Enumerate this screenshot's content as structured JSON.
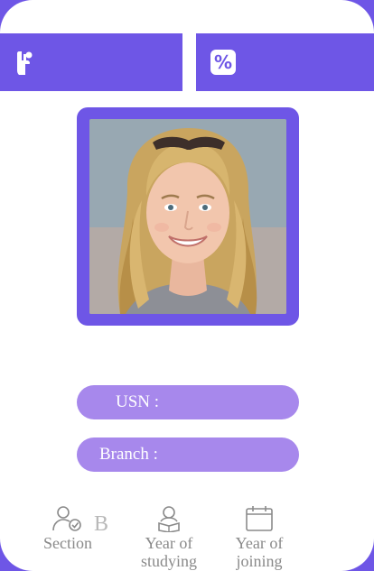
{
  "header": {
    "left_button_icon": "hand-raise-icon",
    "right_button_icon": "percent-icon",
    "right_button_glyph": "%"
  },
  "profile": {
    "photo_alt": "Student photo"
  },
  "fields": {
    "usn_label": "USN :",
    "branch_label": "Branch :"
  },
  "bottom_bar": {
    "section_label": "Section",
    "section_value": "B",
    "studying_label": "Year of studying",
    "joining_label": "Year of joining"
  },
  "colors": {
    "accent": "#6E56E6",
    "pill": "#A788EC",
    "muted_text": "#8A8A8A"
  }
}
